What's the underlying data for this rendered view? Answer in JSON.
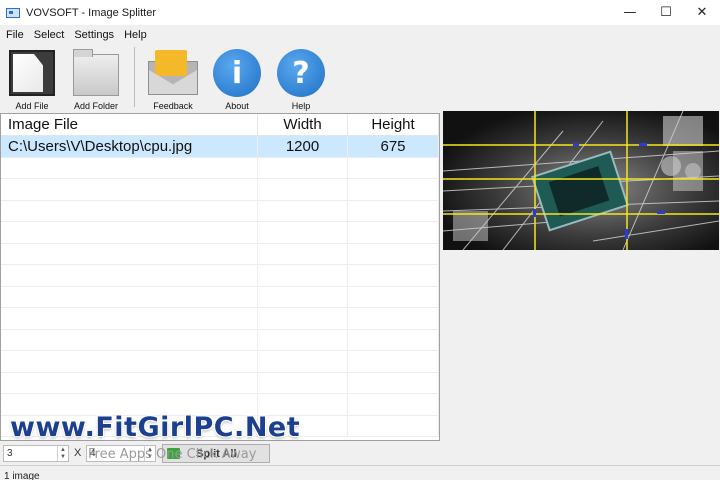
{
  "window": {
    "title": "VOVSOFT - Image Splitter",
    "controls": {
      "minimize": "—",
      "maximize": "☐",
      "close": "✕"
    }
  },
  "menu": [
    "File",
    "Select",
    "Settings",
    "Help"
  ],
  "toolbar": {
    "add_file": "Add File",
    "add_folder": "Add Folder",
    "feedback": "Feedback",
    "about": "About",
    "about_glyph": "i",
    "help": "Help",
    "help_glyph": "?"
  },
  "table": {
    "columns": [
      "Image File",
      "Width",
      "Height"
    ],
    "rows": [
      {
        "file": "C:\\Users\\V\\Desktop\\cpu.jpg",
        "width": "1200",
        "height": "675",
        "selected": true
      }
    ]
  },
  "preview": {
    "image": "circuit-board-cpu-photo",
    "grid_color": "#f5e61c",
    "marker_color": "#2b3bd9"
  },
  "controls": {
    "rows_value": "3",
    "x_label": "X",
    "cols_value": "4",
    "split_all": "Split All"
  },
  "status": {
    "text": "1 image"
  },
  "watermark": {
    "text": "www.FitGirlPC.Net",
    "subtext": "Free Apps One Click Away"
  },
  "colors": {
    "selection": "#cce8ff",
    "icon_blue": "#1f6fc4",
    "feedback_yellow": "#f3b92a",
    "watermark": "#1c3f8f"
  }
}
